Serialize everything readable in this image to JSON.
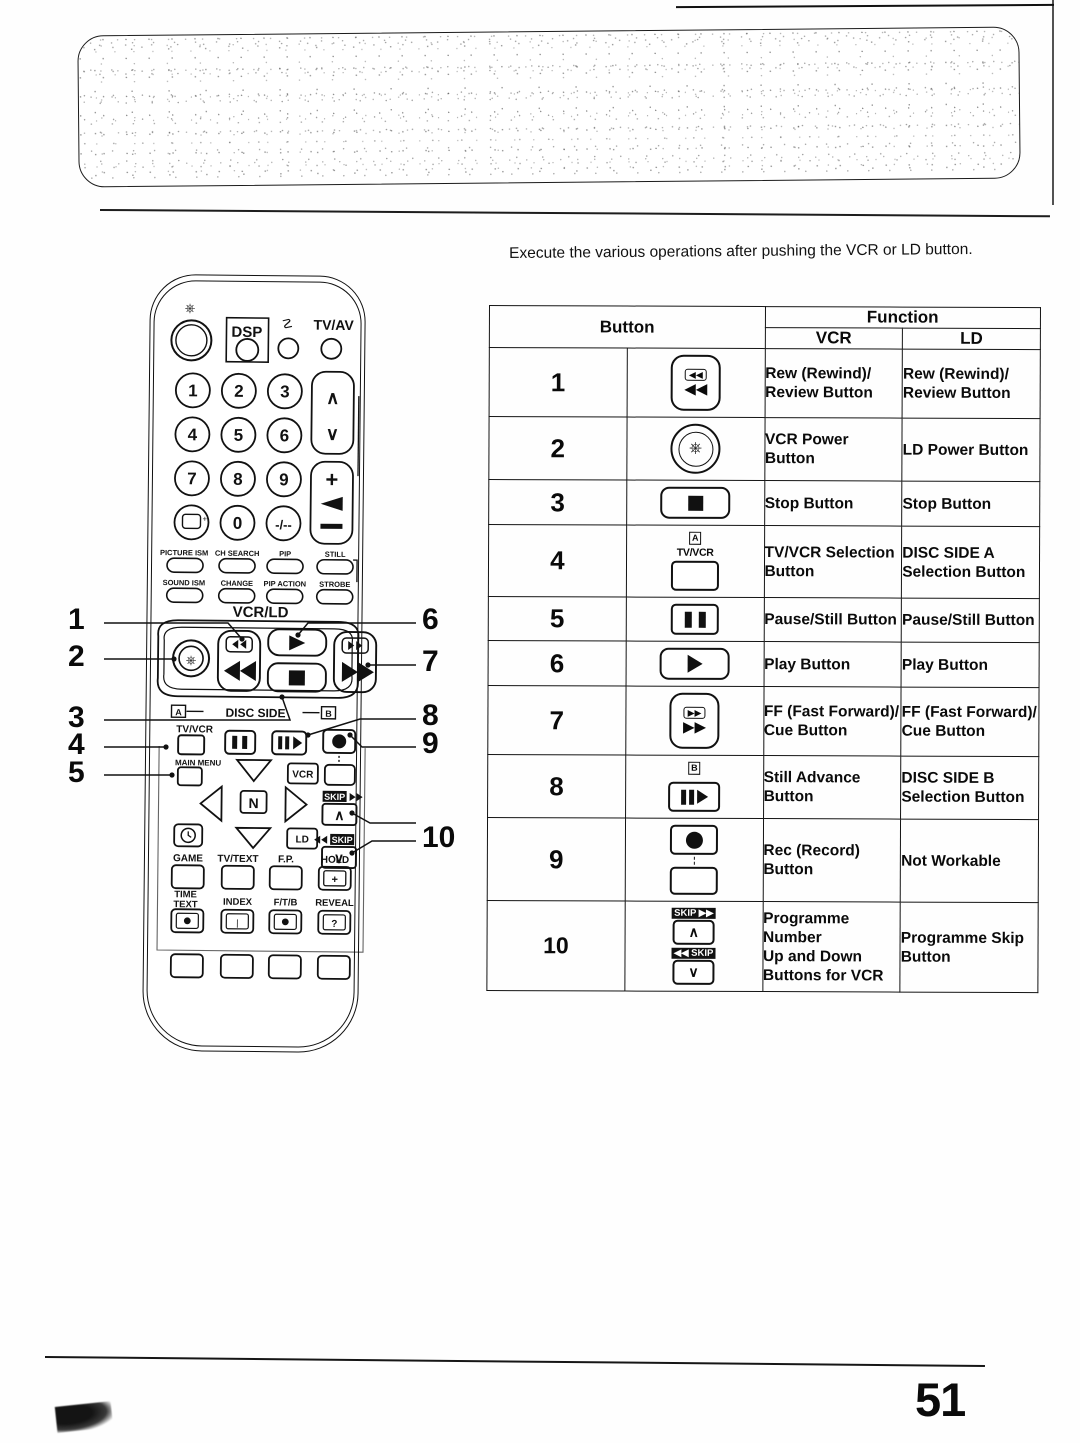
{
  "page": {
    "number": "51"
  },
  "intro": {
    "text": "Execute the various operations after pushing the VCR or LD button."
  },
  "table": {
    "header": {
      "button": "Button",
      "function": "Function",
      "vcr": "VCR",
      "ld": "LD"
    },
    "rows": [
      {
        "num": "1",
        "icon": "rewind-review-button-icon",
        "icon_labels": [
          "◀◀",
          "◀◀"
        ],
        "vcr": "Rew (Rewind)/\nReview Button",
        "ld": "Rew (Rewind)/\nReview Button"
      },
      {
        "num": "2",
        "icon": "power-button-icon",
        "icon_labels": [
          "⏻"
        ],
        "vcr": "VCR Power Button",
        "ld": "LD Power Button"
      },
      {
        "num": "3",
        "icon": "stop-button-icon",
        "icon_labels": [
          "■"
        ],
        "vcr": "Stop Button",
        "ld": "Stop Button"
      },
      {
        "num": "4",
        "icon": "tv-vcr-selection-button-icon",
        "icon_labels": [
          "A",
          "TV/VCR"
        ],
        "vcr": "TV/VCR Selection\nButton",
        "ld": "DISC SIDE A\nSelection Button"
      },
      {
        "num": "5",
        "icon": "pause-still-button-icon",
        "icon_labels": [
          "❙❙"
        ],
        "vcr": "Pause/Still Button",
        "ld": "Pause/Still Button"
      },
      {
        "num": "6",
        "icon": "play-button-icon",
        "icon_labels": [
          "▶"
        ],
        "vcr": "Play Button",
        "ld": "Play Button"
      },
      {
        "num": "7",
        "icon": "fast-forward-cue-button-icon",
        "icon_labels": [
          "▶▶",
          "▶▶"
        ],
        "vcr": "FF (Fast Forward)/\nCue Button",
        "ld": "FF (Fast Forward)/\nCue Button"
      },
      {
        "num": "8",
        "icon": "still-advance-button-icon",
        "icon_labels": [
          "B",
          "❙❙▶"
        ],
        "vcr": "Still Advance\nButton",
        "ld": "DISC SIDE B\nSelection Button"
      },
      {
        "num": "9",
        "icon": "record-button-icon",
        "icon_labels": [
          "●",
          ""
        ],
        "vcr": "Rec (Record)\nButton",
        "ld": "Not Workable"
      },
      {
        "num": "10",
        "icon": "programme-skip-buttons-icon",
        "icon_labels": [
          "SKIP ▶▶",
          "∧",
          "◀◀ SKIP",
          "∨"
        ],
        "vcr": "Programme Number\nUp and Down\nButtons for VCR",
        "ld": "Programme Skip\nButton"
      }
    ]
  },
  "remote": {
    "name": "vcr-ld-remote-control",
    "callouts_left": [
      "1",
      "2",
      "3",
      "4",
      "5"
    ],
    "callouts_right": [
      "6",
      "7",
      "8",
      "9",
      "10"
    ],
    "top_row": {
      "power": "power-icon",
      "dsp": "DSP",
      "mute": "mute-icon",
      "tv_av": "TV/AV"
    },
    "keypad": [
      "1",
      "2",
      "3",
      "4",
      "5",
      "6",
      "7",
      "8",
      "9",
      "0"
    ],
    "keypad_extra": [
      "picture-recall-icon",
      "dash-dash"
    ],
    "channel": {
      "up": "∧",
      "down": "∨"
    },
    "volume": {
      "up": "+",
      "down": "−",
      "icon": "volume-icon"
    },
    "function_row1": [
      "PICTURE ISM",
      "CH SEARCH",
      "PIP",
      "STILL"
    ],
    "function_row2": [
      "SOUND ISM",
      "CHANGE",
      "PIP ACTION",
      "STROBE"
    ],
    "vcr_ld_label": "VCR/LD",
    "disc_side_label": "DISC SIDE",
    "disc_side_a": "A",
    "disc_side_b": "B",
    "tv_vcr_label": "TV/VCR",
    "main_menu_label": "MAIN MENU",
    "nav_center": "N",
    "source_vcr": "VCR",
    "source_ld": "LD",
    "skip_up_label": "SKIP ▶▶",
    "skip_down_label": "◀◀ SKIP",
    "bottom_row1": [
      "GAME",
      "TV/TEXT",
      "F.P.",
      "HOLD"
    ],
    "bottom_row2": [
      "TIME TEXT",
      "INDEX",
      "F/T/B",
      "REVEAL"
    ]
  }
}
